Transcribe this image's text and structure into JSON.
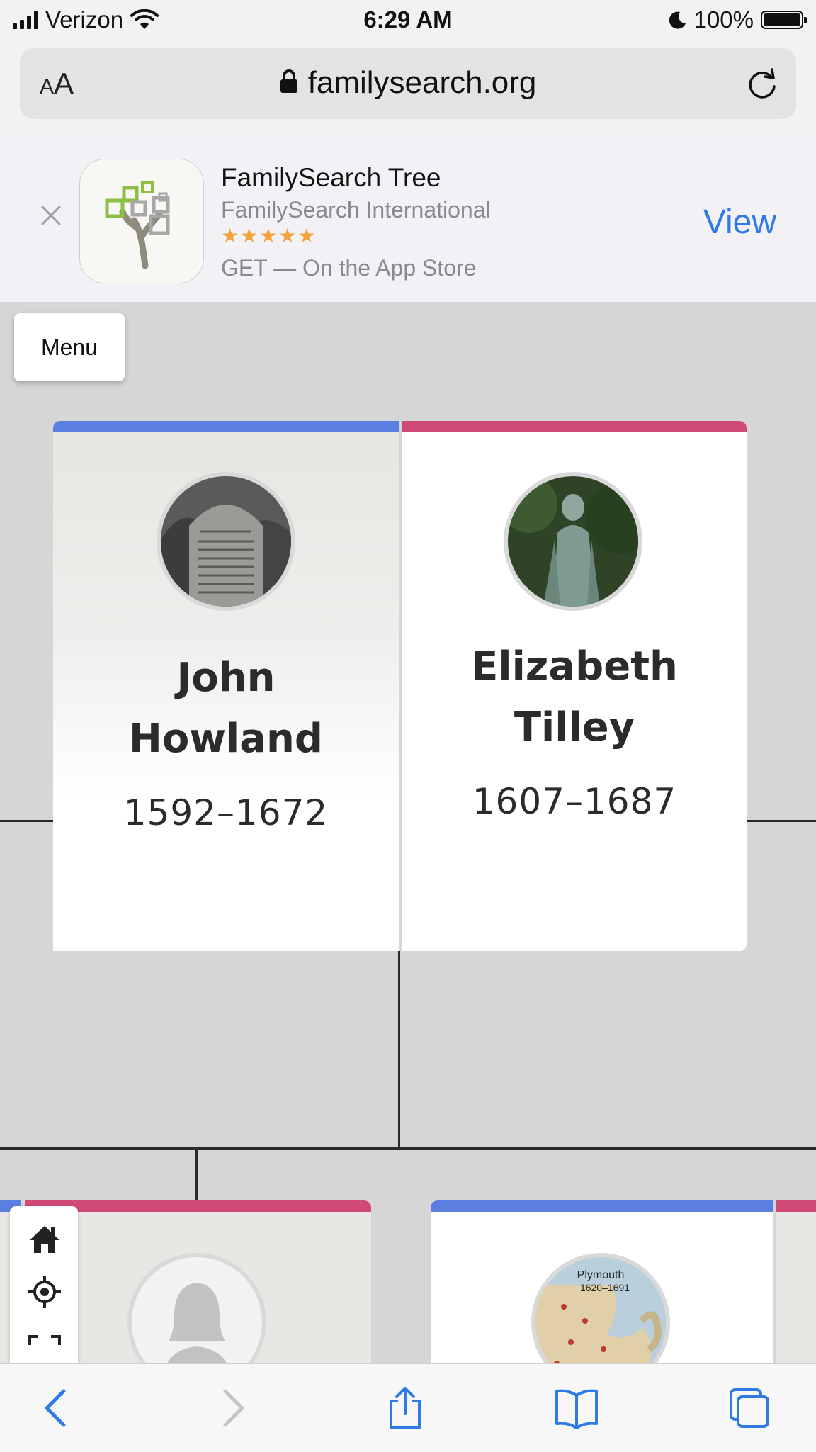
{
  "status_bar": {
    "carrier": "Verizon",
    "time": "6:29 AM",
    "battery": "100%"
  },
  "browser": {
    "text_size_label": "AA",
    "url": "familysearch.org"
  },
  "app_banner": {
    "app_name": "FamilySearch Tree",
    "developer": "FamilySearch International",
    "rating_stars": "★★★★★",
    "get_text": "GET — On the App Store",
    "view_label": "View",
    "star_color": "#f2a43a",
    "view_color": "#2f7ae5"
  },
  "page": {
    "menu_label": "Menu",
    "couple": [
      {
        "name_line1": "John",
        "name_line2": "Howland",
        "years": "1592–1672",
        "gender": "male"
      },
      {
        "name_line1": "Elizabeth",
        "name_line2": "Tilley",
        "years": "1607–1687",
        "gender": "female"
      }
    ],
    "map_thumb_title": "Plymouth",
    "map_thumb_years": "1620–1691",
    "colors": {
      "male": "#5a7fe0",
      "female": "#d04a77"
    }
  },
  "tools": [
    "home-icon",
    "recenter-icon",
    "fullscreen-icon"
  ],
  "toolbar": [
    "back-icon",
    "forward-icon",
    "share-icon",
    "bookmarks-icon",
    "tabs-icon"
  ]
}
